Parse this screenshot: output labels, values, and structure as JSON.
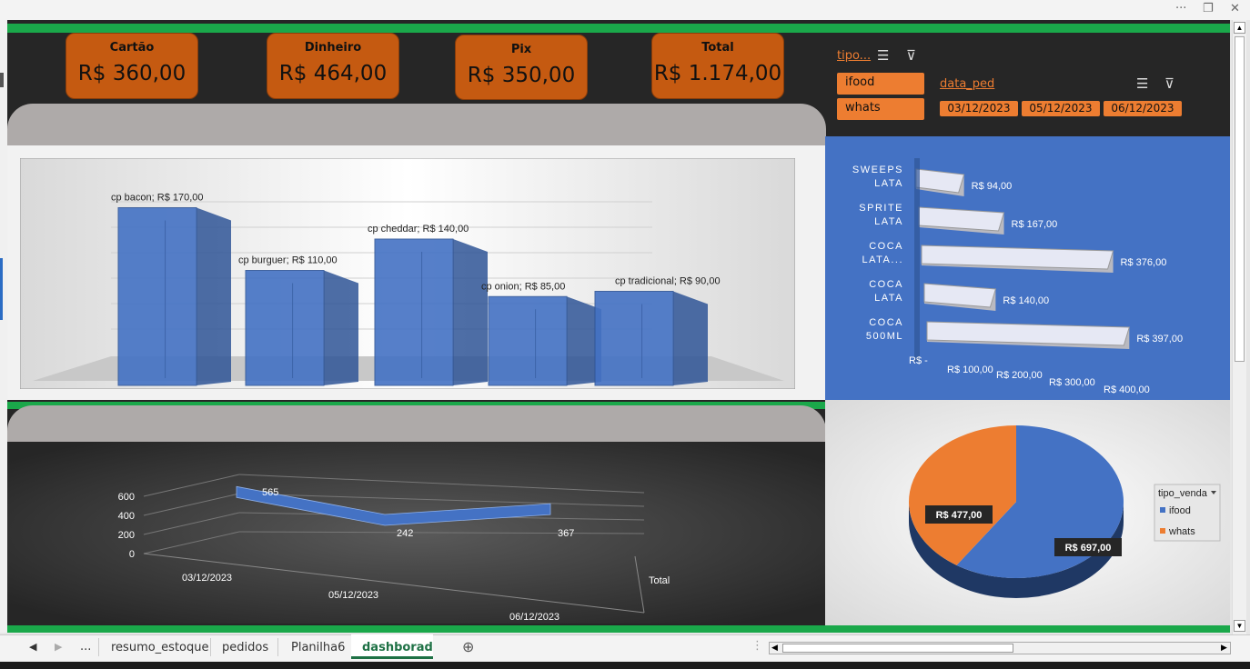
{
  "window": {
    "more_icon": "ellipsis-icon",
    "restore_icon": "restore-icon",
    "close_icon": "close-icon"
  },
  "cards": [
    {
      "label": "Cartão",
      "value": "R$ 360,00"
    },
    {
      "label": "Dinheiro",
      "value": "R$ 464,00"
    },
    {
      "label": "Pix",
      "value": "R$ 350,00"
    },
    {
      "label": "Total",
      "value": "R$ 1.174,00"
    }
  ],
  "slicer_tipo": {
    "title": "tipo...",
    "items": [
      "ifood",
      "whats"
    ]
  },
  "slicer_data": {
    "title": "data_ped",
    "items": [
      "03/12/2023",
      "05/12/2023",
      "06/12/2023"
    ]
  },
  "colors": {
    "accent": "#ed7d31",
    "card": "#c55a11",
    "bar": "#4472c4",
    "green": "#1aa84a"
  },
  "chart_data": [
    {
      "type": "bar",
      "categories": [
        "cp bacon",
        "cp burguer",
        "cp cheddar",
        "cp onion",
        "cp tradicional"
      ],
      "values": [
        170,
        110,
        140,
        85,
        90
      ],
      "data_labels": [
        "cp bacon;  R$ 170,00",
        "cp burguer;  R$ 110,00",
        "cp cheddar;  R$ 140,00",
        "cp onion;  R$ 85,00",
        "cp tradicional;  R$ 90,00"
      ]
    },
    {
      "type": "bar",
      "orientation": "horizontal",
      "categories": [
        "SWEEPS LATA",
        "SPRITE LATA",
        "COCA LATA...",
        "COCA LATA",
        "COCA 500ML"
      ],
      "values": [
        94,
        167,
        376,
        140,
        397
      ],
      "data_labels": [
        "R$ 94,00",
        "R$ 167,00",
        "R$ 376,00",
        "R$ 140,00",
        "R$ 397,00"
      ],
      "x_ticks": [
        "R$ -",
        "R$ 100,00",
        "R$ 200,00",
        "R$ 300,00",
        "R$ 400,00"
      ]
    },
    {
      "type": "line",
      "categories": [
        "03/12/2023",
        "05/12/2023",
        "06/12/2023"
      ],
      "values": [
        565,
        242,
        367
      ],
      "y_ticks": [
        "0",
        "200",
        "400",
        "600"
      ],
      "series_label": "Total"
    },
    {
      "type": "pie",
      "labels": [
        "ifood",
        "whats"
      ],
      "values": [
        697,
        477
      ],
      "data_labels": [
        "R$ 697,00",
        "R$ 477,00"
      ],
      "legend_title": "tipo_venda",
      "legend_position": "right"
    }
  ],
  "tabs": {
    "prev_icon": "tab-prev-icon",
    "next_icon": "tab-next-icon",
    "more": "...",
    "items": [
      "resumo_estoque",
      "pedidos",
      "Planilha6",
      "dashborad"
    ],
    "active": "dashborad"
  }
}
